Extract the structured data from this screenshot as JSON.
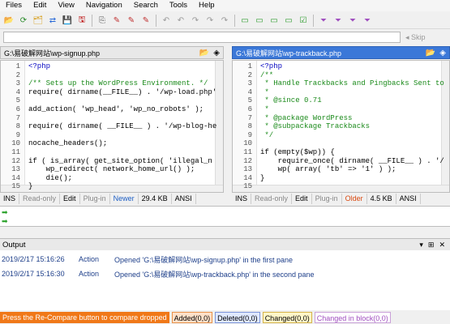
{
  "menu": [
    "Files",
    "Edit",
    "View",
    "Navigation",
    "Search",
    "Tools",
    "Help"
  ],
  "toolbar_icons": [
    "open-folder-icon",
    "reload-icon",
    "folder-tree-icon",
    "folder-compare-icon",
    "save-icon",
    "save-as-icon",
    "copy-icon",
    "edit-icon",
    "edit-icon",
    "edit-icon",
    "undo-icon",
    "undo-icon",
    "redo-icon",
    "redo-icon",
    "redo-icon",
    "frame-icon",
    "frame-icon",
    "frame-icon",
    "frame-icon",
    "check-frame-icon",
    "filter-icon",
    "filter-icon",
    "filter-icon",
    "filter-icon"
  ],
  "toolbar2": {
    "skip_label": "Skip"
  },
  "left_pane": {
    "path": "G:\\易破解网站\\wp-signup.php",
    "lines": [
      {
        "n": "1",
        "t": "<?php",
        "cls": "c-kw"
      },
      {
        "n": "2",
        "t": "",
        "cls": ""
      },
      {
        "n": "3",
        "t": "/** Sets up the WordPress Environment. */",
        "cls": "c-comment"
      },
      {
        "n": "4",
        "t": "require( dirname(__FILE__) . '/wp-load.php'",
        "cls": ""
      },
      {
        "n": "5",
        "t": "",
        "cls": ""
      },
      {
        "n": "6",
        "t": "add_action( 'wp_head', 'wp_no_robots' );",
        "cls": ""
      },
      {
        "n": "7",
        "t": "",
        "cls": ""
      },
      {
        "n": "8",
        "t": "require( dirname( __FILE__ ) . '/wp-blog-he",
        "cls": ""
      },
      {
        "n": "9",
        "t": "",
        "cls": ""
      },
      {
        "n": "10",
        "t": "nocache_headers();",
        "cls": ""
      },
      {
        "n": "11",
        "t": "",
        "cls": ""
      },
      {
        "n": "12",
        "t": "if ( is_array( get_site_option( 'illegal_n",
        "cls": ""
      },
      {
        "n": "13",
        "t": "    wp_redirect( network_home_url() );",
        "cls": ""
      },
      {
        "n": "14",
        "t": "    die();",
        "cls": ""
      },
      {
        "n": "15",
        "t": "}",
        "cls": ""
      }
    ],
    "status": [
      "INS",
      "Read-only",
      "Edit",
      "Plug-in",
      "Newer",
      "29.4 KB",
      "ANSI"
    ]
  },
  "right_pane": {
    "path": "G:\\易破解网站\\wp-trackback.php",
    "lines": [
      {
        "n": "1",
        "t": "<?php",
        "cls": "c-kw"
      },
      {
        "n": "2",
        "t": "/**",
        "cls": "c-comment"
      },
      {
        "n": "3",
        "t": " * Handle Trackbacks and Pingbacks Sent to",
        "cls": "c-comment"
      },
      {
        "n": "4",
        "t": " *",
        "cls": "c-comment"
      },
      {
        "n": "5",
        "t": " * @since 0.71",
        "cls": "c-comment"
      },
      {
        "n": "6",
        "t": " *",
        "cls": "c-comment"
      },
      {
        "n": "7",
        "t": " * @package WordPress",
        "cls": "c-comment"
      },
      {
        "n": "8",
        "t": " * @subpackage Trackbacks",
        "cls": "c-comment"
      },
      {
        "n": "9",
        "t": " */",
        "cls": "c-comment"
      },
      {
        "n": "10",
        "t": "",
        "cls": ""
      },
      {
        "n": "11",
        "t": "if (empty($wp)) {",
        "cls": ""
      },
      {
        "n": "12",
        "t": "    require_once( dirname( __FILE__ ) . '/",
        "cls": ""
      },
      {
        "n": "13",
        "t": "    wp( array( 'tb' => '1' ) );",
        "cls": ""
      },
      {
        "n": "14",
        "t": "}",
        "cls": ""
      },
      {
        "n": "15",
        "t": "",
        "cls": ""
      }
    ],
    "status": [
      "INS",
      "Read-only",
      "Edit",
      "Plug-in",
      "Older",
      "4.5 KB",
      "ANSI"
    ]
  },
  "output": {
    "title": "Output",
    "rows": [
      {
        "time": "2019/2/17 15:16:26",
        "type": "Action",
        "msg": "Opened 'G:\\易破解网站\\wp-signup.php' in the first pane"
      },
      {
        "time": "2019/2/17 15:16:30",
        "type": "Action",
        "msg": "Opened 'G:\\易破解网站\\wp-trackback.php' in the second pane"
      }
    ]
  },
  "bottom": {
    "message": "Press the Re-Compare button to compare dropped",
    "added": "Added(0,0)",
    "deleted": "Deleted(0,0)",
    "changed": "Changed(0,0)",
    "changed_in_block": "Changed in block(0,0)"
  }
}
